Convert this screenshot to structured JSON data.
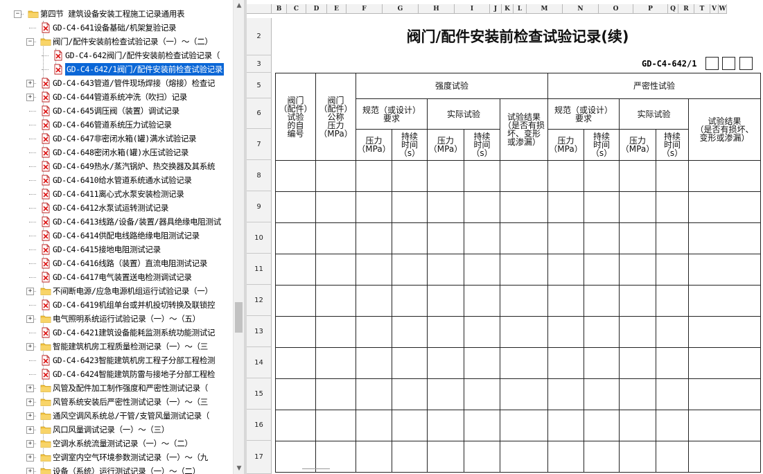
{
  "tree": {
    "items": [
      {
        "level": 0,
        "type": "folder",
        "expanded": true,
        "label": "第四节 建筑设备安装工程施工记录通用表"
      },
      {
        "level": 1,
        "type": "doc",
        "label": "GD-C4-641设备基础/机架复验记录"
      },
      {
        "level": 1,
        "type": "folder",
        "expanded": true,
        "label": "阀门/配件安装前检查试验记录（一）～（二）"
      },
      {
        "level": 2,
        "type": "doc",
        "label": "GD-C4-642阀门/配件安装前检查试验记录（"
      },
      {
        "level": 2,
        "type": "doc",
        "label": "GD-C4-642/1阀门/配件安装前检查试验记录",
        "selected": true
      },
      {
        "level": 1,
        "type": "doc",
        "toggle": true,
        "label": "GD-C4-643管道/管件现场焊接（熔接）检查记"
      },
      {
        "level": 1,
        "type": "doc",
        "toggle": true,
        "label": "GD-C4-644管道系统冲洗（吹扫）记录"
      },
      {
        "level": 1,
        "type": "doc",
        "label": "GD-C4-645调压阀（装置）调试记录"
      },
      {
        "level": 1,
        "type": "doc",
        "label": "GD-C4-646管道系统压力试验记录"
      },
      {
        "level": 1,
        "type": "doc",
        "label": "GD-C4-647非密闭水箱(罐)满水试验记录"
      },
      {
        "level": 1,
        "type": "doc",
        "label": "GD-C4-648密闭水箱(罐)水压试验记录"
      },
      {
        "level": 1,
        "type": "doc",
        "label": "GD-C4-649热水/蒸汽锅炉、热交换器及其系统"
      },
      {
        "level": 1,
        "type": "doc",
        "label": "GD-C4-6410给水管道系统通水试验记录"
      },
      {
        "level": 1,
        "type": "doc",
        "label": "GD-C4-6411离心式水泵安装检测记录"
      },
      {
        "level": 1,
        "type": "doc",
        "label": "GD-C4-6412水泵试运转测试记录"
      },
      {
        "level": 1,
        "type": "doc",
        "label": "GD-C4-6413线路/设备/装置/器具绝缘电阻测试"
      },
      {
        "level": 1,
        "type": "doc",
        "label": "GD-C4-6414供配电线路绝缘电阻测试记录"
      },
      {
        "level": 1,
        "type": "doc",
        "label": "GD-C4-6415接地电阻测试记录"
      },
      {
        "level": 1,
        "type": "doc",
        "label": "GD-C4-6416线路（装置）直流电阻测试记录"
      },
      {
        "level": 1,
        "type": "doc",
        "label": "GD-C4-6417电气装置送电检测调试记录"
      },
      {
        "level": 1,
        "type": "folder",
        "expanded": false,
        "label": "不间断电源/应急电源机组运行试验记录（一）"
      },
      {
        "level": 1,
        "type": "doc",
        "label": "GD-C4-6419机组单台或并机投切转换及联锁控"
      },
      {
        "level": 1,
        "type": "folder",
        "expanded": false,
        "label": "电气照明系统运行试验记录（一）～（五）"
      },
      {
        "level": 1,
        "type": "doc",
        "label": "GD-C4-6421建筑设备能耗监测系统功能测试记"
      },
      {
        "level": 1,
        "type": "folder",
        "expanded": false,
        "label": "智能建筑机房工程质量检测记录（一）～（三"
      },
      {
        "level": 1,
        "type": "doc",
        "label": "GD-C4-6423智能建筑机房工程子分部工程检测"
      },
      {
        "level": 1,
        "type": "doc",
        "label": "GD-C4-6424智能建筑防雷与接地子分部工程检"
      },
      {
        "level": 1,
        "type": "folder",
        "expanded": false,
        "label": "风管及配件加工制作强度和严密性测试记录（"
      },
      {
        "level": 1,
        "type": "folder",
        "expanded": false,
        "label": "风管系统安装后严密性测试记录（一）～（三"
      },
      {
        "level": 1,
        "type": "folder",
        "expanded": false,
        "label": "通风空调风系统总/干管/支管风量测试记录（"
      },
      {
        "level": 1,
        "type": "folder",
        "expanded": false,
        "label": "风口风量调试记录（一）～（三）"
      },
      {
        "level": 1,
        "type": "folder",
        "expanded": false,
        "label": "空调水系统流量测试记录（一）～（二）"
      },
      {
        "level": 1,
        "type": "folder",
        "expanded": false,
        "label": "空调室内空气环境参数测试记录（一）～（九"
      },
      {
        "level": 1,
        "type": "folder",
        "expanded": false,
        "label": "设备（系统）运行测试记录（一）～（二）"
      }
    ],
    "icons": {
      "folder": "folder-icon",
      "doc": "pdf-document-icon"
    }
  },
  "sheet": {
    "columns": [
      "B",
      "C",
      "D",
      "E",
      "F",
      "G",
      "H",
      "I",
      "J",
      "K",
      "L",
      "M",
      "N",
      "O",
      "P",
      "Q",
      "R",
      "T",
      "V",
      "W"
    ],
    "rows": [
      "2",
      "3",
      "5",
      "6",
      "7",
      "8",
      "9",
      "10",
      "11",
      "12",
      "13",
      "14",
      "15",
      "16",
      "17"
    ],
    "title": "阀门/配件安装前检查试验记录(续)",
    "code": "GD-C4-642/1",
    "table": {
      "h_item": "阀门\n（配件）\n试验\n的自\n编号",
      "h_pressure": "阀门\n（配件）\n公称\n压力\n（MPa）",
      "h_strength": "强度试验",
      "h_tightness": "严密性试验",
      "h_spec": "规范（或设计）\n要求",
      "h_actual": "实际试验",
      "h_result1": "试验结果\n（是否有损\n坏、变形\n或渗漏）",
      "h_result2": "试验结果\n（是否有损坏、\n变形或渗漏）",
      "h_press": "压力\n（MPa）",
      "h_dur": "持续\n时间\n（s）"
    }
  }
}
